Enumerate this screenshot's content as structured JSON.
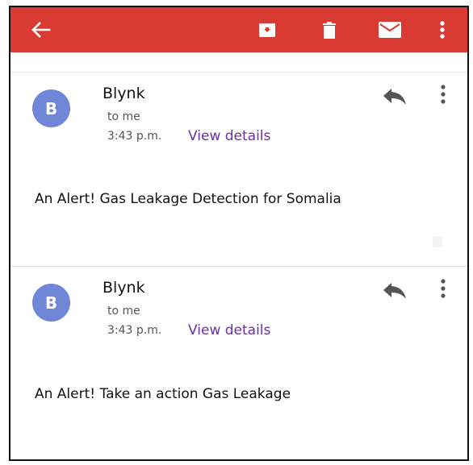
{
  "appbar": {
    "back_icon": "arrow-left-icon",
    "archive_icon": "archive-icon",
    "delete_icon": "trash-icon",
    "mark_unread_icon": "mail-icon",
    "more_icon": "more-vertical-icon",
    "color": "#d93b32"
  },
  "messages": [
    {
      "avatar": "B",
      "sender": "Blynk",
      "to": "to me",
      "time": "3:43 p.m.",
      "details_link": "View details",
      "body": "An Alert! Gas Leakage Detection for Somalia"
    },
    {
      "avatar": "B",
      "sender": "Blynk",
      "to": "to me",
      "time": "3:43 p.m.",
      "details_link": "View details",
      "body": "An Alert! Take an action Gas Leakage"
    }
  ],
  "colors": {
    "avatar": "#7086d6",
    "link": "#6a2fa8"
  }
}
